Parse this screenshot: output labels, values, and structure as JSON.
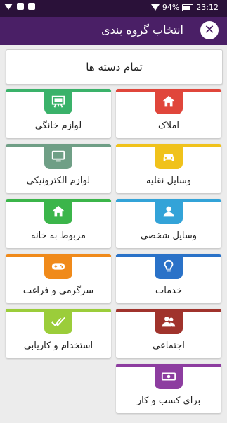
{
  "status": {
    "time": "23:12",
    "battery": "94%"
  },
  "app": {
    "title": "انتخاب گروه بندی"
  },
  "all_label": "تمام دسته ها",
  "categories": [
    {
      "label": "املاک",
      "color": "#e0463b",
      "icon": "house-icon"
    },
    {
      "label": "لوازم خانگی",
      "color": "#3ab26a",
      "icon": "projector-board-icon"
    },
    {
      "label": "وسایل نقلیه",
      "color": "#f0c21b",
      "icon": "car-icon"
    },
    {
      "label": "لوازم الکترونیکی",
      "color": "#6f9f86",
      "icon": "monitor-icon"
    },
    {
      "label": "وسایل شخصی",
      "color": "#33a3d8",
      "icon": "person-icon"
    },
    {
      "label": "مربوط به خانه",
      "color": "#3bb54a",
      "icon": "house-icon"
    },
    {
      "label": "خدمات",
      "color": "#2a72c8",
      "icon": "lightbulb-icon"
    },
    {
      "label": "سرگرمی و فراغت",
      "color": "#f08a1a",
      "icon": "gamepad-icon"
    },
    {
      "label": "اجتماعی",
      "color": "#a0332c",
      "icon": "people-icon"
    },
    {
      "label": "استخدام و کاریابی",
      "color": "#9bcd3a",
      "icon": "check-marks-icon"
    },
    {
      "label": "برای کسب و کار",
      "color": "#8d3da0",
      "icon": "money-icon"
    }
  ]
}
